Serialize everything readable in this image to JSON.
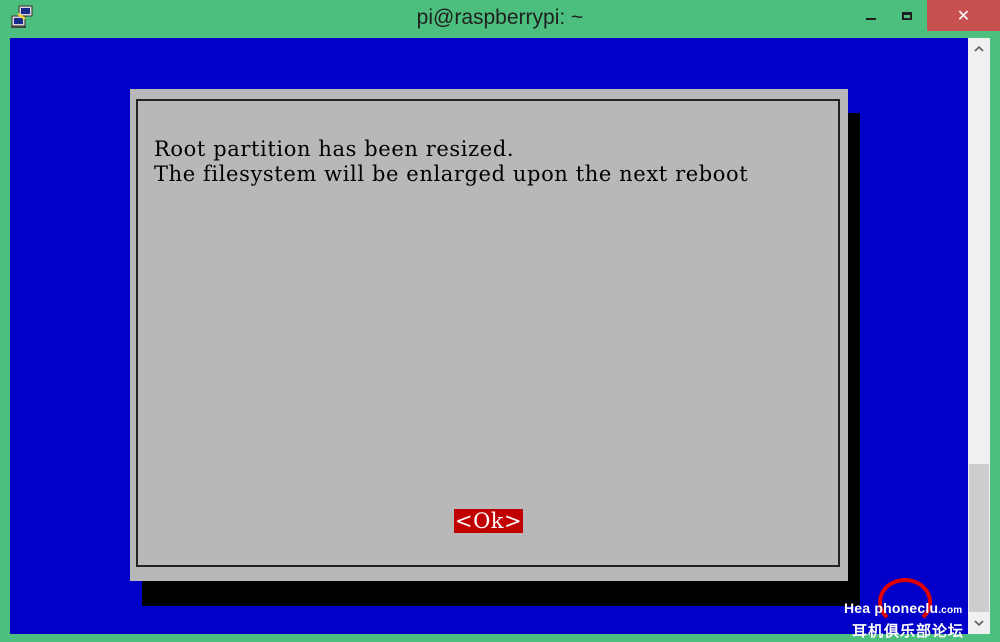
{
  "window": {
    "title": "pi@raspberrypi: ~",
    "app_icon": "putty-icon",
    "minimize_icon": "minimize-icon",
    "maximize_icon": "maximize-icon",
    "close_icon": "close-icon",
    "close_glyph": "✕"
  },
  "dialog": {
    "message": "Root partition has been resized.\nThe filesystem will be enlarged upon the next reboot",
    "ok_label": "<Ok>"
  },
  "watermark": {
    "brand": "HeadphoneClub",
    "line1": "Hea  phoneclu",
    "line1_suffix": ".com",
    "line2": "耳机俱乐部论坛"
  },
  "colors": {
    "frame": "#4cbf7e",
    "terminal_bg": "#0000c8",
    "dialog_bg": "#b8b8b8",
    "button_bg": "#c00000",
    "close_bg": "#c75050"
  }
}
